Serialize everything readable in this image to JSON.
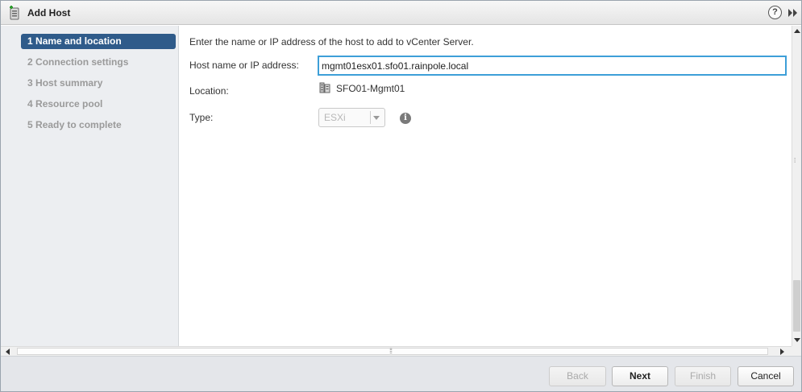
{
  "dialog": {
    "title": "Add Host"
  },
  "colors": {
    "active_step": "#2f5b8a",
    "input_focus_border": "#3d9fd8",
    "sidebar_bg": "#eceef1",
    "footer_bg": "#e4e6ea"
  },
  "icons": {
    "title": "add-host-icon",
    "help": "help-icon",
    "expand": "double-chevron-right-icon",
    "location": "datacenter-icon",
    "info": "info-icon"
  },
  "steps": [
    {
      "number": "1",
      "label": "Name and location",
      "state": "active"
    },
    {
      "number": "2",
      "label": "Connection settings",
      "state": "inactive"
    },
    {
      "number": "3",
      "label": "Host summary",
      "state": "inactive"
    },
    {
      "number": "4",
      "label": "Resource pool",
      "state": "inactive"
    },
    {
      "number": "5",
      "label": "Ready to complete",
      "state": "inactive"
    }
  ],
  "form": {
    "instruction": "Enter the name or IP address of the host to add to vCenter Server.",
    "host_label": "Host name or IP address:",
    "host_value": "mgmt01esx01.sfo01.rainpole.local",
    "location_label": "Location:",
    "location_value": "SFO01-Mgmt01",
    "type_label": "Type:",
    "type_value": "ESXi",
    "help_glyph": "?",
    "info_glyph": "i"
  },
  "buttons": {
    "back": "Back",
    "next": "Next",
    "finish": "Finish",
    "cancel": "Cancel"
  }
}
